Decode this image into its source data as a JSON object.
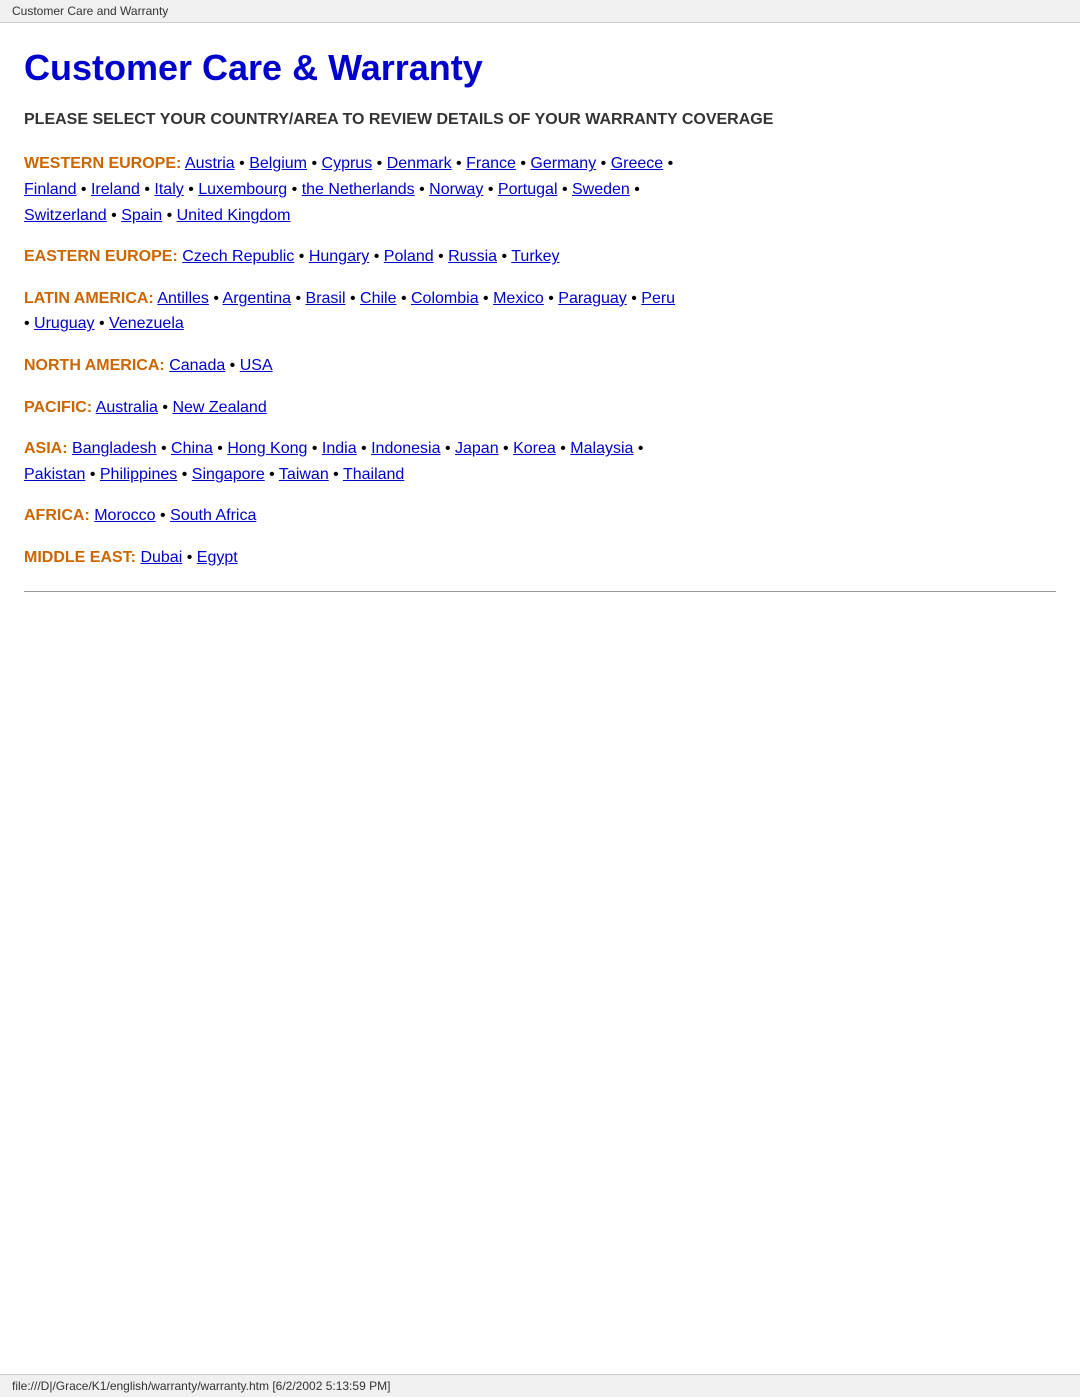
{
  "browser_tab": {
    "title": "Customer Care and Warranty"
  },
  "page": {
    "title": "Customer Care & Warranty",
    "subtitle": "PLEASE SELECT YOUR COUNTRY/AREA TO REVIEW DETAILS OF YOUR WARRANTY COVERAGE"
  },
  "regions": [
    {
      "id": "western-europe",
      "label": "WESTERN EUROPE:",
      "countries": [
        "Austria",
        "Belgium",
        "Cyprus",
        "Denmark",
        "France",
        "Germany",
        "Greece",
        "Finland",
        "Ireland",
        "Italy",
        "Luxembourg",
        "the Netherlands",
        "Norway",
        "Portugal",
        "Sweden",
        "Switzerland",
        "Spain",
        "United Kingdom"
      ]
    },
    {
      "id": "eastern-europe",
      "label": "EASTERN EUROPE:",
      "countries": [
        "Czech Republic",
        "Hungary",
        "Poland",
        "Russia",
        "Turkey"
      ]
    },
    {
      "id": "latin-america",
      "label": "LATIN AMERICA:",
      "countries": [
        "Antilles",
        "Argentina",
        "Brasil",
        "Chile",
        "Colombia",
        "Mexico",
        "Paraguay",
        "Peru",
        "Uruguay",
        "Venezuela"
      ]
    },
    {
      "id": "north-america",
      "label": "NORTH AMERICA:",
      "countries": [
        "Canada",
        "USA"
      ]
    },
    {
      "id": "pacific",
      "label": "PACIFIC:",
      "countries": [
        "Australia",
        "New Zealand"
      ]
    },
    {
      "id": "asia",
      "label": "ASIA:",
      "countries": [
        "Bangladesh",
        "China",
        "Hong Kong",
        "India",
        "Indonesia",
        "Japan",
        "Korea",
        "Malaysia",
        "Pakistan",
        "Philippines",
        "Singapore",
        "Taiwan",
        "Thailand"
      ]
    },
    {
      "id": "africa",
      "label": "AFRICA:",
      "countries": [
        "Morocco",
        "South Africa"
      ]
    },
    {
      "id": "middle-east",
      "label": "MIDDLE EAST:",
      "countries": [
        "Dubai",
        "Egypt"
      ]
    }
  ],
  "status_bar": {
    "text": "file:///D|/Grace/K1/english/warranty/warranty.htm [6/2/2002 5:13:59 PM]"
  }
}
